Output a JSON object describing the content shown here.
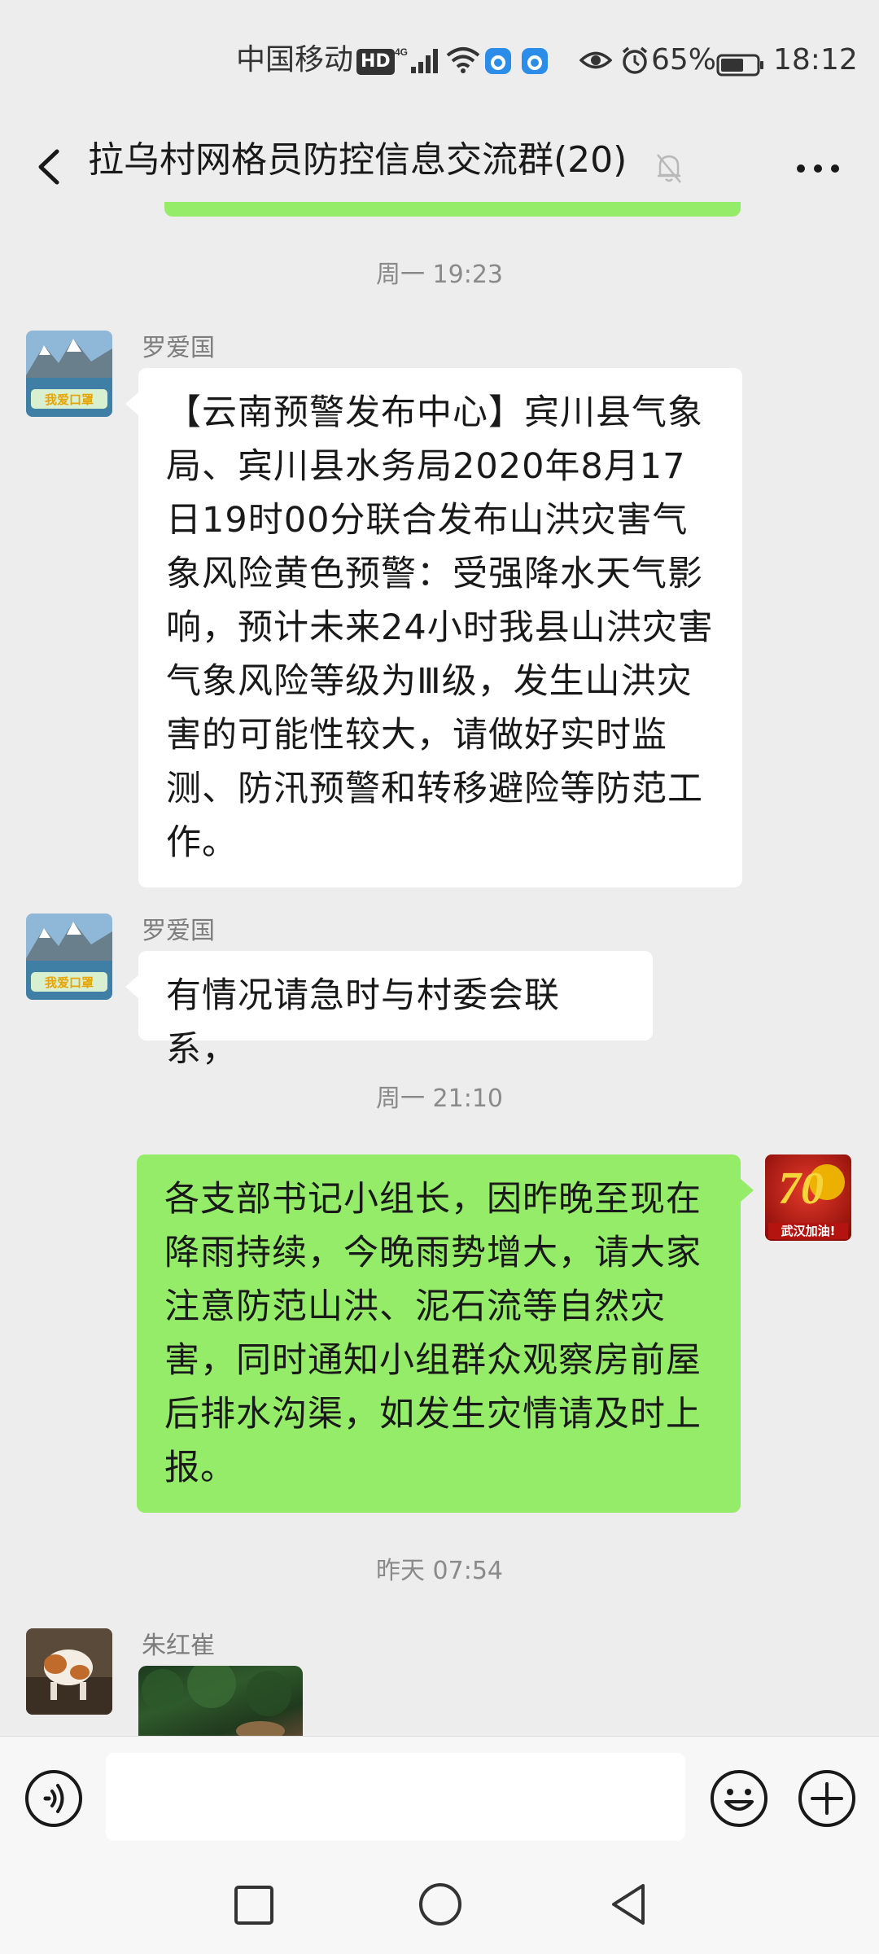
{
  "status_bar": {
    "carrier": "中国移动",
    "hd_badge": "HD",
    "battery_percent": "65%",
    "battery_level": 0.65,
    "time": "18:12",
    "icons": [
      "hd-icon",
      "signal-4g-icon",
      "wifi-icon",
      "app-icon",
      "app-icon",
      "eye-icon",
      "alarm-icon",
      "battery-icon"
    ]
  },
  "header": {
    "title": "拉乌村网格员防控信息交流群(20)",
    "icons": [
      "back-icon",
      "mute-bell-icon",
      "more-icon"
    ]
  },
  "messages": [
    {
      "type": "timestamp",
      "text": "周一 19:23"
    },
    {
      "type": "incoming",
      "sender": "罗爱国",
      "text": "【云南预警发布中心】宾川县气象局、宾川县水务局2020年8月17日19时00分联合发布山洪灾害气象风险黄色预警：受强降水天气影响，预计未来24小时我县山洪灾害气象风险等级为Ⅲ级，发生山洪灾害的可能性较大，请做好实时监测、防汛预警和转移避险等防范工作。"
    },
    {
      "type": "incoming",
      "sender": "罗爱国",
      "text": "有情况请急时与村委会联系，"
    },
    {
      "type": "timestamp",
      "text": "周一 21:10"
    },
    {
      "type": "outgoing",
      "text": "各支部书记小组长，因昨晚至现在降雨持续，今晚雨势增大，请大家注意防范山洪、泥石流等自然灾害，同时通知小组群众观察房前屋后排水沟渠，如发生灾情请及时上报。"
    },
    {
      "type": "timestamp",
      "text": "昨天 07:54"
    },
    {
      "type": "incoming-image",
      "sender": "朱红崔"
    }
  ],
  "avatars": {
    "luo_badge": "我爱口罩",
    "self_number": "70",
    "self_badge": "武汉加油!"
  },
  "input_bar": {
    "placeholder": "",
    "icons": [
      "voice-icon",
      "emoji-icon",
      "plus-icon"
    ]
  },
  "system_nav": {
    "icons": [
      "recent-apps-icon",
      "home-icon",
      "back-triangle-icon"
    ]
  },
  "colors": {
    "background": "#ededed",
    "outgoing_bubble": "#95ec69",
    "incoming_bubble": "#ffffff",
    "timestamp_text": "#8a8a8a"
  }
}
